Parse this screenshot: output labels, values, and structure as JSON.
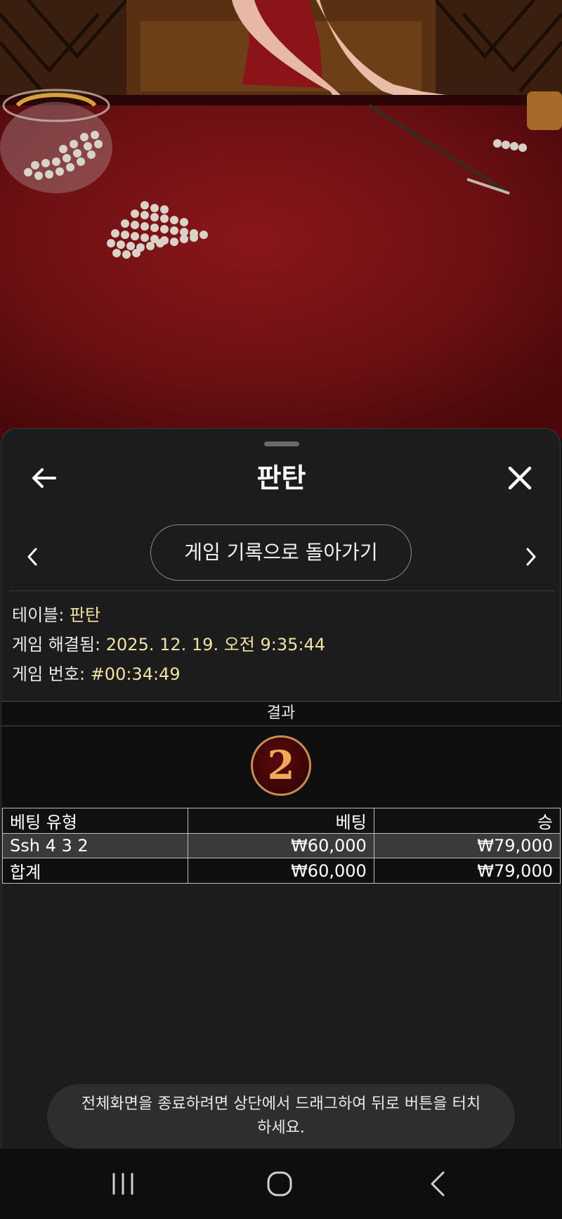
{
  "sheet": {
    "title": "판탄",
    "history_button_label": "게임 기록으로 돌아가기"
  },
  "info": {
    "table_label": "테이블:",
    "table_value": "판탄",
    "resolved_label": "게임 해결됨:",
    "resolved_value": "2025. 12. 19. 오전 9:35:44",
    "game_no_label": "게임 번호:",
    "game_no_value": "#00:34:49"
  },
  "result": {
    "header": "결과",
    "number": "2"
  },
  "bets": {
    "columns": [
      "베팅 유형",
      "베팅",
      "승"
    ],
    "rows": [
      {
        "type": "Ssh 4 3 2",
        "bet": "₩60,000",
        "win": "₩79,000"
      }
    ],
    "total": {
      "label": "합계",
      "bet": "₩60,000",
      "win": "₩79,000"
    }
  },
  "toast": {
    "message": "전체화면을 종료하려면 상단에서 드래그하여 뒤로 버튼을 터치하세요."
  },
  "icons": {
    "back": "arrow-left-icon",
    "close": "close-icon",
    "prev": "chevron-left-icon",
    "next": "chevron-right-icon",
    "recent_apps": "recent-apps-icon",
    "home": "home-icon",
    "system_back": "system-back-icon"
  },
  "colors": {
    "table_felt": "#6a1012",
    "sheet_bg": "#1c1c1c",
    "info_value": "#f3e1a4",
    "result_ball_ring": "#c98d55",
    "result_digit": "#f0a85a"
  }
}
